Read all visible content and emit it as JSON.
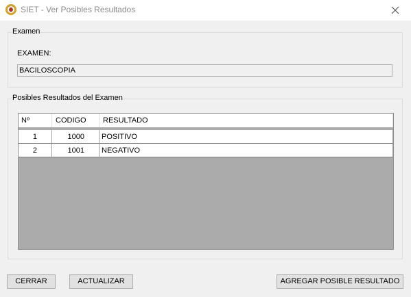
{
  "window": {
    "title": "SIET - Ver Posibles Resultados"
  },
  "examen_group": {
    "legend": "Examen",
    "label": "EXAMEN:",
    "value": "BACILOSCOPIA"
  },
  "resultados_group": {
    "legend": "Posibles Resultados del Examen",
    "columns": [
      "Nº",
      "CODIGO",
      "RESULTADO"
    ],
    "rows": [
      {
        "num": "1",
        "codigo": "1000",
        "resultado": "POSITIVO"
      },
      {
        "num": "2",
        "codigo": "1001",
        "resultado": "NEGATIVO"
      }
    ]
  },
  "buttons": {
    "cerrar": "CERRAR",
    "actualizar": "ACTUALIZAR",
    "agregar": "AGREGAR POSIBLE RESULTADO"
  },
  "icons": {
    "app": "siet-logo-icon",
    "close": "close-icon"
  }
}
